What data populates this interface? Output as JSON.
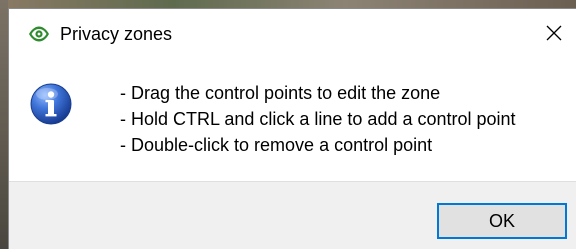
{
  "window": {
    "title": "Privacy zones",
    "app_icon": "eye-icon",
    "close_icon": "close-icon",
    "accent_color": "#0078d7"
  },
  "message": {
    "icon": "information-icon",
    "lines": [
      "- Drag the control points to edit the zone",
      "- Hold CTRL and click a line to add a control point",
      "- Double-click to remove a control point"
    ]
  },
  "buttons": {
    "ok_label": "OK"
  }
}
